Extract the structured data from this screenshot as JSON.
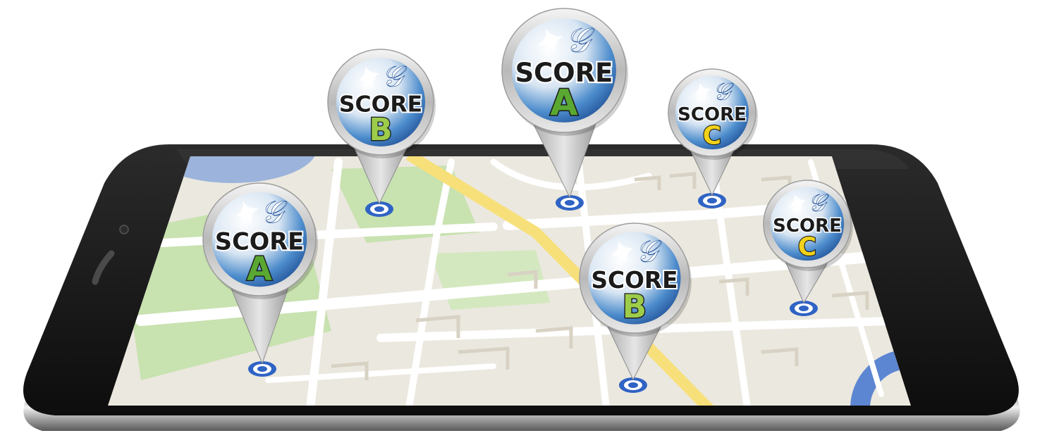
{
  "pins": [
    {
      "label": "SCORE",
      "grade": "A",
      "grade_color": "#5aa832",
      "logo_text": "𝒢"
    },
    {
      "label": "SCORE",
      "grade": "B",
      "grade_color": "#9ccc4a",
      "logo_text": "𝒢"
    },
    {
      "label": "SCORE",
      "grade": "A",
      "grade_color": "#5aa832",
      "logo_text": "𝒢"
    },
    {
      "label": "SCORE",
      "grade": "C",
      "grade_color": "#f2d21a",
      "logo_text": "𝒢"
    },
    {
      "label": "SCORE",
      "grade": "B",
      "grade_color": "#9ccc4a",
      "logo_text": "𝒢"
    },
    {
      "label": "SCORE",
      "grade": "C",
      "grade_color": "#f2d21a",
      "logo_text": "𝒢"
    }
  ],
  "colors": {
    "map_bg": "#ebe8df",
    "park": "#c8e2b0",
    "road": "#ffffff",
    "highway": "#f7e07a",
    "water": "#9cb4dc",
    "phone_body": "#1a1a1a",
    "pin_ring": "#c9c9c9",
    "target": "#2f63c4"
  }
}
